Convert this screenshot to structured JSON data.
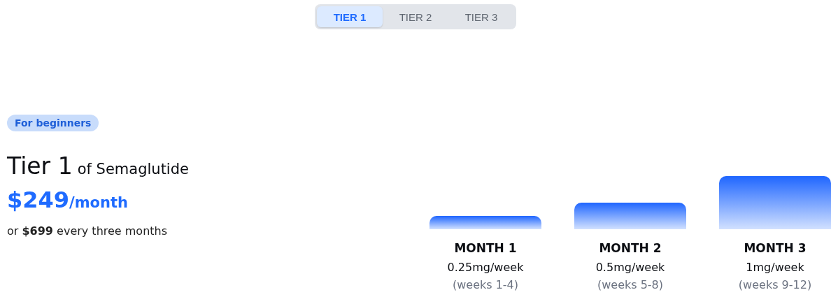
{
  "tabs": [
    {
      "label": "TIER 1",
      "selected": true
    },
    {
      "label": "TIER 2",
      "selected": false
    },
    {
      "label": "TIER 3",
      "selected": false
    }
  ],
  "plan": {
    "badge": "For beginners",
    "title": "Tier 1",
    "title_suffix": "of Semaglutide",
    "price": "$249",
    "price_unit": "/month",
    "alternative": "or **$699** every three months"
  },
  "months": [
    {
      "label": "MONTH 1",
      "dose": "0.25mg/week",
      "weeks": "(weeks 1-4)"
    },
    {
      "label": "MONTH 2",
      "dose": "0.5mg/week",
      "weeks": "(weeks 5-8)"
    },
    {
      "label": "MONTH 3",
      "dose": "1mg/week",
      "weeks": "(weeks 9-12)"
    }
  ]
}
